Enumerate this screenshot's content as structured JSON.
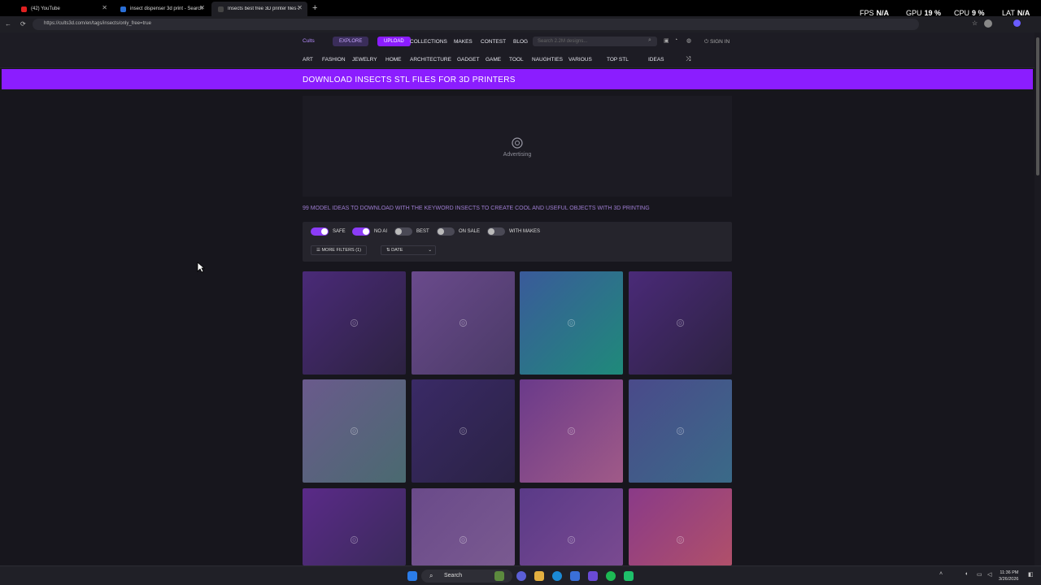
{
  "browser": {
    "tabs": [
      {
        "title": "(42) YouTube"
      },
      {
        "title": "insect dispenser 3d print - Search"
      },
      {
        "title": "Insects best free 3D printer files·3D"
      }
    ],
    "url": "https://cults3d.com/en/tags/insects/only_free=true"
  },
  "hud": {
    "fps_label": "FPS",
    "fps_value": "N/A",
    "gpu_label": "GPU",
    "gpu_value": "19 %",
    "cpu_label": "CPU",
    "cpu_value": "9 %",
    "lat_label": "LAT",
    "lat_value": "N/A"
  },
  "site": {
    "logo": "Cults",
    "explore": "EXPLORE",
    "upload": "UPLOAD",
    "nav": [
      "COLLECTIONS",
      "MAKES",
      "CONTEST",
      "BLOG"
    ],
    "search_placeholder": "Search 2.2M designs...",
    "signin": "SIGN IN",
    "categories": [
      "ART",
      "FASHION",
      "JEWELRY",
      "HOME",
      "ARCHITECTURE",
      "GADGET",
      "GAME",
      "TOOL",
      "NAUGHTIES",
      "VARIOUS",
      "TOP STL",
      "IDEAS"
    ],
    "accent": "#8b1dff"
  },
  "page": {
    "banner_title": "DOWNLOAD INSECTS STL FILES FOR 3D PRINTERS",
    "ad_label": "Advertising",
    "tagline": "99 MODEL IDEAS TO DOWNLOAD WITH THE KEYWORD INSECTS TO CREATE COOL AND USEFUL OBJECTS WITH 3D PRINTING",
    "filters": [
      {
        "label": "SAFE",
        "on": true
      },
      {
        "label": "NO AI",
        "on": true
      },
      {
        "label": "BEST",
        "on": false
      },
      {
        "label": "ON SALE",
        "on": false
      },
      {
        "label": "WITH MAKES",
        "on": false
      }
    ],
    "more_filters": "MORE FILTERS  (1)",
    "sort": "DATE"
  },
  "taskbar": {
    "search": "Search",
    "time": "11:36 PM",
    "date": "3/26/2026"
  }
}
